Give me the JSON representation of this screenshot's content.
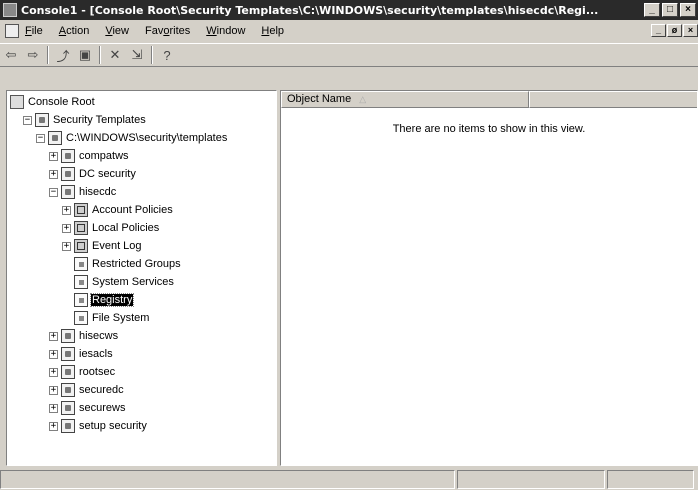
{
  "window": {
    "title": "Console1 - [Console Root\\Security Templates\\C:\\WINDOWS\\security\\templates\\hisecdc\\Regi..."
  },
  "window_buttons": [
    "_",
    "□",
    "×"
  ],
  "mdi_buttons": [
    "_",
    "ø",
    "×"
  ],
  "menu": [
    {
      "pre": "",
      "u": "F",
      "post": "ile"
    },
    {
      "pre": "",
      "u": "A",
      "post": "ction"
    },
    {
      "pre": "",
      "u": "V",
      "post": "iew"
    },
    {
      "pre": "Fav",
      "u": "o",
      "post": "rites"
    },
    {
      "pre": "",
      "u": "W",
      "post": "indow"
    },
    {
      "pre": "",
      "u": "H",
      "post": "elp"
    }
  ],
  "toolbar": [
    "back-icon",
    "forward-icon",
    "up-folder-icon",
    "show-hide-tree-icon",
    "delete-icon",
    "export-list-icon",
    "help-icon"
  ],
  "toolbar_glyphs": {
    "back": "⇦",
    "forward": "⇨",
    "up": "⤴",
    "tree": "▣",
    "delete": "✕",
    "export": "⇲",
    "help": "?"
  },
  "tree": [
    {
      "label": "Console Root",
      "indent": 0,
      "expander": "",
      "icon": "folder"
    },
    {
      "label": "Security Templates",
      "indent": 1,
      "expander": "−",
      "icon": "tmpl"
    },
    {
      "label": "C:\\WINDOWS\\security\\templates",
      "indent": 2,
      "expander": "−",
      "icon": "tmpl"
    },
    {
      "label": "compatws",
      "indent": 3,
      "expander": "+",
      "icon": "tmpl"
    },
    {
      "label": "DC security",
      "indent": 3,
      "expander": "+",
      "icon": "tmpl"
    },
    {
      "label": "hisecdc",
      "indent": 3,
      "expander": "−",
      "icon": "tmpl"
    },
    {
      "label": "Account Policies",
      "indent": 4,
      "expander": "+",
      "icon": "policy"
    },
    {
      "label": "Local Policies",
      "indent": 4,
      "expander": "+",
      "icon": "policy"
    },
    {
      "label": "Event Log",
      "indent": 4,
      "expander": "+",
      "icon": "policy"
    },
    {
      "label": "Restricted Groups",
      "indent": 4,
      "expander": "",
      "icon": "page"
    },
    {
      "label": "System Services",
      "indent": 4,
      "expander": "",
      "icon": "page"
    },
    {
      "label": "Registry",
      "indent": 4,
      "expander": "",
      "icon": "page",
      "selected": true
    },
    {
      "label": "File System",
      "indent": 4,
      "expander": "",
      "icon": "page"
    },
    {
      "label": "hisecws",
      "indent": 3,
      "expander": "+",
      "icon": "tmpl"
    },
    {
      "label": "iesacls",
      "indent": 3,
      "expander": "+",
      "icon": "tmpl"
    },
    {
      "label": "rootsec",
      "indent": 3,
      "expander": "+",
      "icon": "tmpl"
    },
    {
      "label": "securedc",
      "indent": 3,
      "expander": "+",
      "icon": "tmpl"
    },
    {
      "label": "securews",
      "indent": 3,
      "expander": "+",
      "icon": "tmpl"
    },
    {
      "label": "setup security",
      "indent": 3,
      "expander": "+",
      "icon": "tmpl"
    }
  ],
  "list": {
    "columns": [
      "Object Name",
      ""
    ],
    "sort_indicator": "△",
    "empty_message": "There are no items to show in this view."
  }
}
